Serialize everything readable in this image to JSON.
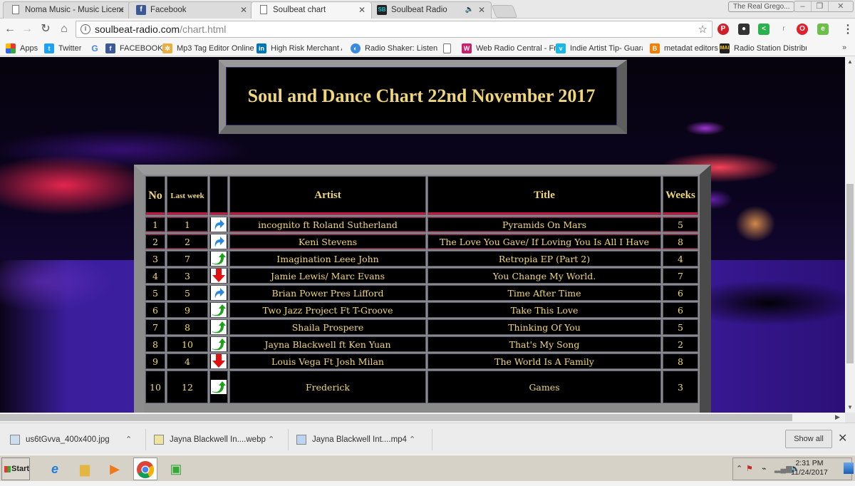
{
  "browser": {
    "tabs": [
      {
        "title": "Noma Music - Music Licensi",
        "icon": "page-icon",
        "active": false
      },
      {
        "title": "Facebook",
        "icon": "facebook-icon",
        "active": false
      },
      {
        "title": "Soulbeat chart",
        "icon": "page-icon",
        "active": true
      },
      {
        "title": "Soulbeat Radio",
        "icon": "soulbeat-icon",
        "active": false,
        "audio": true
      }
    ],
    "profile": "The Real Grego...",
    "url_host": "soulbeat-radio.com",
    "url_path": "/chart.html",
    "bookmarks": [
      {
        "label": "Apps",
        "icon": "apps-icon"
      },
      {
        "label": "Twitter",
        "icon": "twitter-icon"
      },
      {
        "label": "",
        "icon": "google-icon"
      },
      {
        "label": "FACEBOOK",
        "icon": "facebook-icon"
      },
      {
        "label": "Mp3 Tag Editor Online",
        "icon": "mp3tag-icon"
      },
      {
        "label": "High Risk Merchant Acc",
        "icon": "linkedin-icon"
      },
      {
        "label": "Radio Shaker: Listen to",
        "icon": "radioshaker-icon"
      },
      {
        "label": "",
        "icon": "page-icon"
      },
      {
        "label": "Web Radio Central - Fr",
        "icon": "webradio-icon"
      },
      {
        "label": "Indie Artist Tip- Guaran",
        "icon": "vimeo-icon"
      },
      {
        "label": "metadat editors",
        "icon": "blogger-icon"
      },
      {
        "label": "Radio Station Distributi",
        "icon": "mai-icon"
      }
    ],
    "bookmarks_more": "»"
  },
  "page": {
    "title": "Soul and Dance Chart 22nd November 2017",
    "columns": {
      "no": "No",
      "last_week": "Last week",
      "movement": "",
      "artist": "Artist",
      "title": "Title",
      "weeks": "Weeks"
    },
    "rows": [
      {
        "no": "1",
        "last_week": "1",
        "movement": "same",
        "artist": "incognito ft Roland Sutherland",
        "title": "Pyramids On Mars",
        "weeks": "5"
      },
      {
        "no": "2",
        "last_week": "2",
        "movement": "same",
        "artist": "Keni Stevens",
        "title": "The Love You Gave/ If Loving You Is All I Have",
        "weeks": "8"
      },
      {
        "no": "3",
        "last_week": "7",
        "movement": "up",
        "artist": "Imagination Leee John",
        "title": "Retropia EP (Part 2)",
        "weeks": "4"
      },
      {
        "no": "4",
        "last_week": "3",
        "movement": "down",
        "artist": "Jamie Lewis/ Marc Evans",
        "title": "You Change My World.",
        "weeks": "7"
      },
      {
        "no": "5",
        "last_week": "5",
        "movement": "same",
        "artist": "Brian Power Pres Lifford",
        "title": "Time After Time",
        "weeks": "6"
      },
      {
        "no": "6",
        "last_week": "9",
        "movement": "up",
        "artist": "Two Jazz Project Ft T-Groove",
        "title": "Take This Love",
        "weeks": "6"
      },
      {
        "no": "7",
        "last_week": "8",
        "movement": "up",
        "artist": "Shaila Prospere",
        "title": "Thinking Of You",
        "weeks": "5"
      },
      {
        "no": "8",
        "last_week": "10",
        "movement": "up",
        "artist": "Jayna Blackwell ft Ken Yuan",
        "title": "That's My Song",
        "weeks": "2"
      },
      {
        "no": "9",
        "last_week": "4",
        "movement": "down",
        "artist": "Louis Vega Ft Josh Milan",
        "title": "The World Is A Family",
        "weeks": "8"
      },
      {
        "no": "10",
        "last_week": "12",
        "movement": "up",
        "artist": "Frederick",
        "title": "Games",
        "weeks": "3"
      }
    ],
    "colors": {
      "gold_text": "#f0d67a",
      "up": "#1aa31a",
      "down": "#e01010",
      "same": "#2a86e0"
    }
  },
  "downloads": {
    "items": [
      {
        "name": "us6tGvva_400x400.jpg",
        "icon": "image-file-icon"
      },
      {
        "name": "Jayna Blackwell In....webp",
        "icon": "webp-file-icon"
      },
      {
        "name": "Jayna Blackwell Int....mp4",
        "icon": "video-file-icon"
      }
    ],
    "show_all": "Show all"
  },
  "taskbar": {
    "start": "Start",
    "apps": [
      "internet-explorer-icon",
      "file-explorer-icon",
      "media-player-icon",
      "chrome-icon",
      "device-icon"
    ],
    "time": "2:31 PM",
    "date": "11/24/2017"
  }
}
